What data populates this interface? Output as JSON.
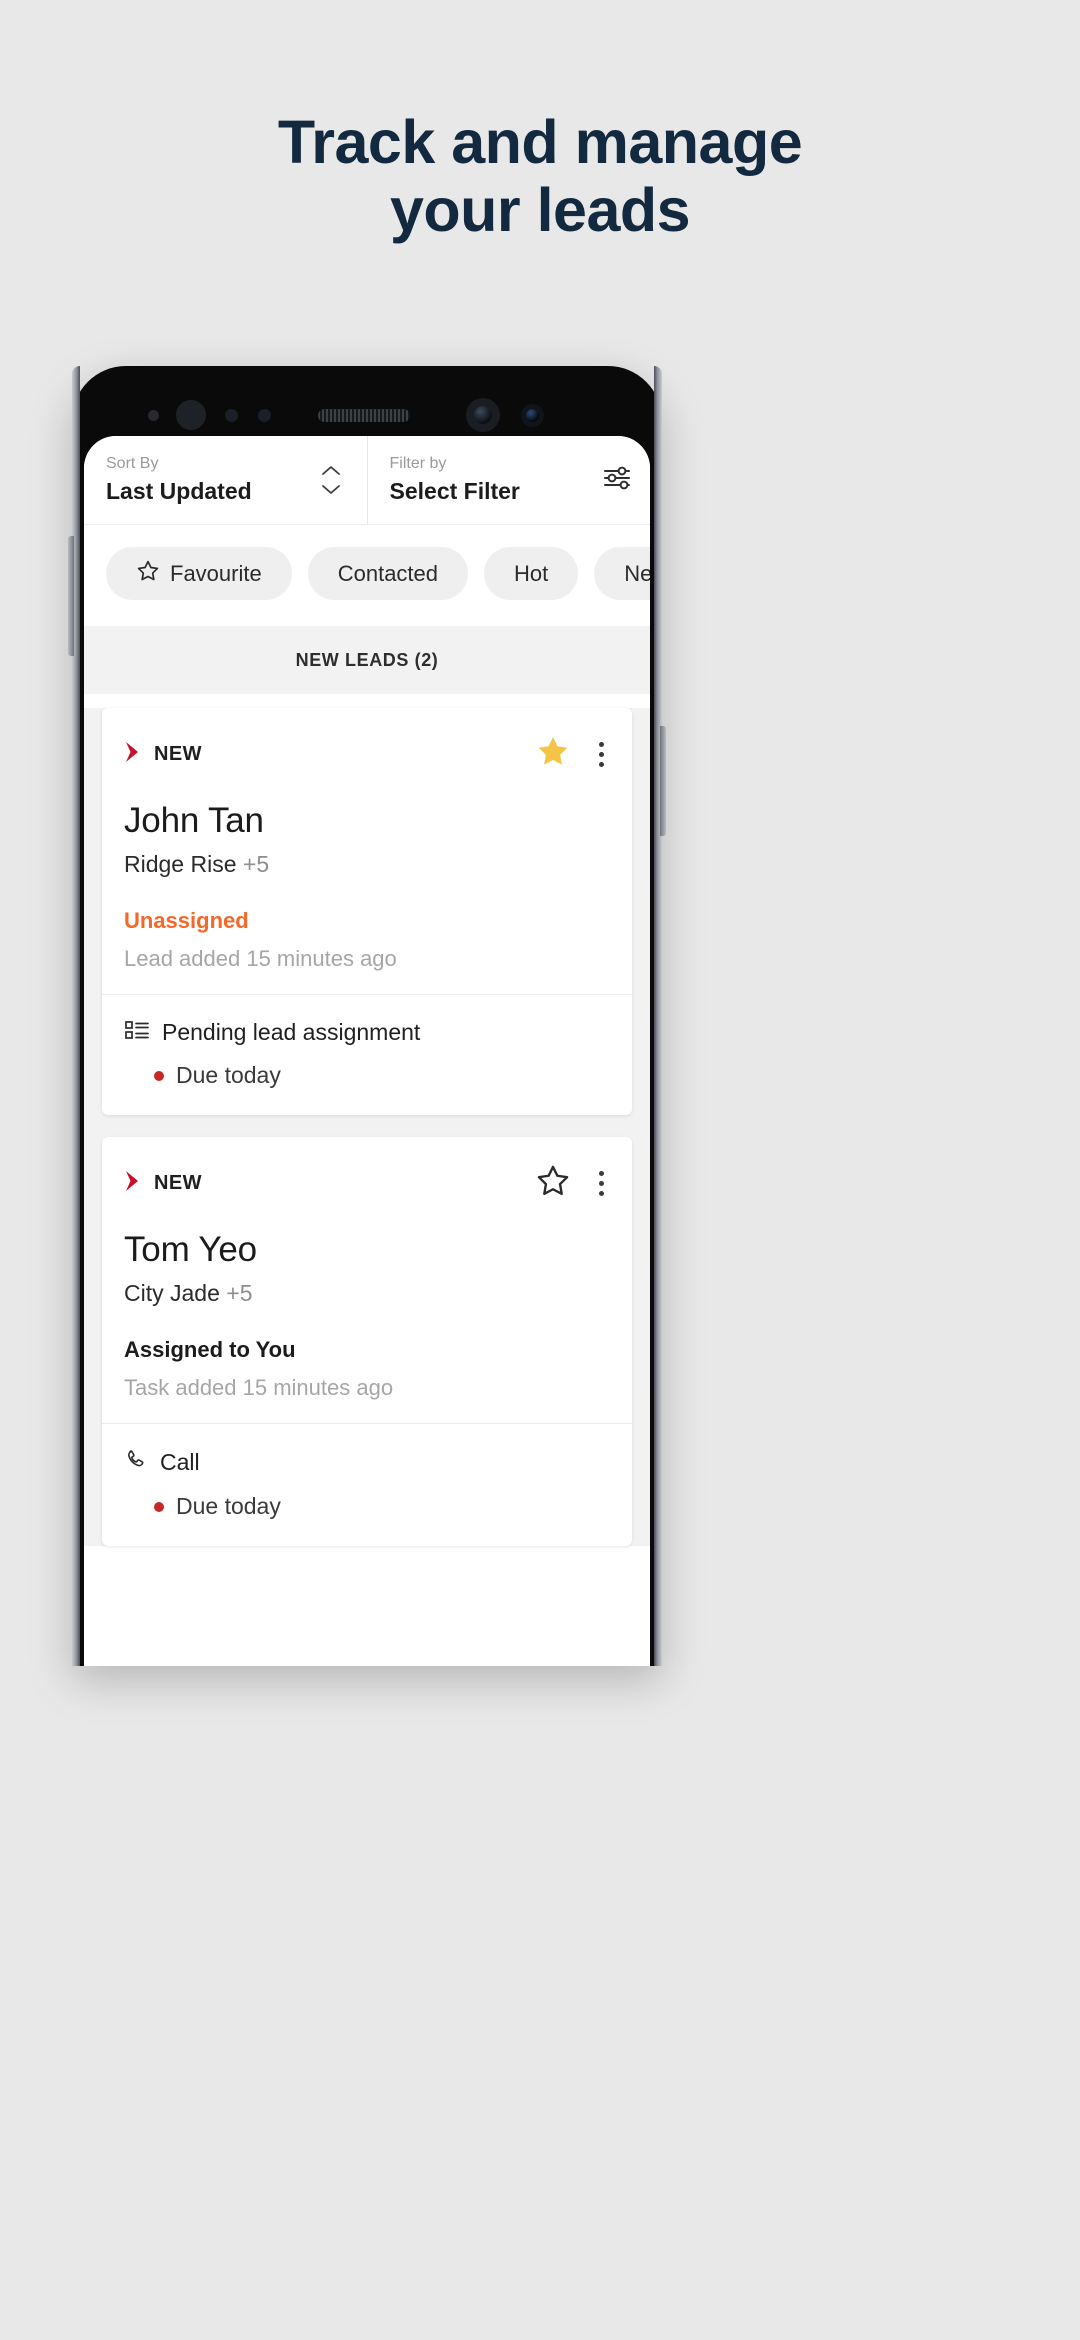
{
  "promo": {
    "heading_line1": "Track and manage",
    "heading_line2": "your leads"
  },
  "colors": {
    "heading": "#12293f",
    "background": "#e8e8e8",
    "accent_red": "#c62828",
    "unassigned_orange": "#f4692a",
    "star_gold": "#f6c445"
  },
  "app": {
    "sort": {
      "label": "Sort By",
      "value": "Last Updated",
      "stepper_icon": "chevron-up-down-icon"
    },
    "filter": {
      "label": "Filter by",
      "value": "Select Filter",
      "settings_icon": "filter-sliders-icon"
    },
    "chips": [
      {
        "label": "Favourite",
        "icon": "star-outline-icon"
      },
      {
        "label": "Contacted",
        "icon": ""
      },
      {
        "label": "Hot",
        "icon": ""
      },
      {
        "label": "Negotia",
        "icon": ""
      }
    ],
    "section_header": "NEW LEADS (2)",
    "leads": [
      {
        "badge": "NEW",
        "badge_icon": "red-chevron-icon",
        "name": "John Tan",
        "property": "Ridge Rise",
        "property_extra": "+5",
        "status": "Unassigned",
        "status_type": "unassigned",
        "meta": "Lead added 15 minutes ago",
        "favourite": true,
        "favourite_icon": "star-filled-icon",
        "menu_icon": "kebab-menu-icon",
        "task": {
          "icon": "list-assignment-icon",
          "label": "Pending lead assignment",
          "due": "Due today"
        }
      },
      {
        "badge": "NEW",
        "badge_icon": "red-chevron-icon",
        "name": "Tom Yeo",
        "property": "City Jade",
        "property_extra": "+5",
        "status": "Assigned to You",
        "status_type": "assigned",
        "meta": "Task added 15 minutes ago",
        "favourite": false,
        "favourite_icon": "star-outline-icon",
        "menu_icon": "kebab-menu-icon",
        "task": {
          "icon": "phone-call-icon",
          "label": "Call",
          "due": "Due today"
        }
      }
    ]
  }
}
